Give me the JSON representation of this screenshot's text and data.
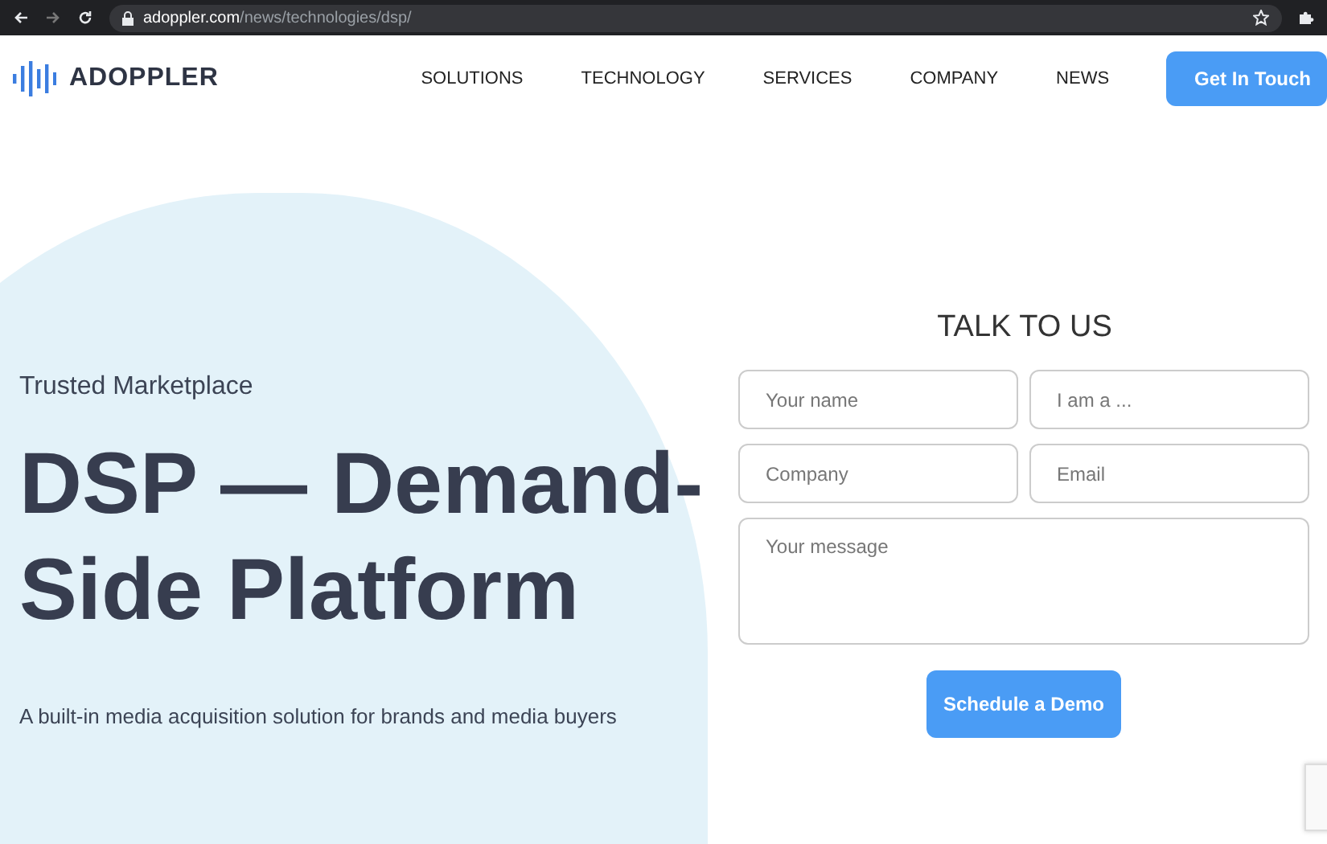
{
  "browser": {
    "url_domain": "adoppler.com",
    "url_path": "/news/technologies/dsp/"
  },
  "header": {
    "logo": "ADOPPLER",
    "nav": [
      {
        "label": "SOLUTIONS"
      },
      {
        "label": "TECHNOLOGY"
      },
      {
        "label": "SERVICES"
      },
      {
        "label": "COMPANY"
      },
      {
        "label": "NEWS"
      }
    ],
    "cta": "Get In Touch"
  },
  "hero": {
    "eyebrow": "Trusted Marketplace",
    "title": "DSP — Demand-Side Platform",
    "subtitle": "A built-in media acquisition solution for brands and media buyers"
  },
  "form": {
    "title": "TALK TO US",
    "fields": [
      {
        "placeholder": "Your name"
      },
      {
        "placeholder": "I am a ..."
      },
      {
        "placeholder": "Company"
      },
      {
        "placeholder": "Email"
      }
    ],
    "message": {
      "placeholder": "Your message"
    },
    "submit": "Schedule a Demo"
  }
}
